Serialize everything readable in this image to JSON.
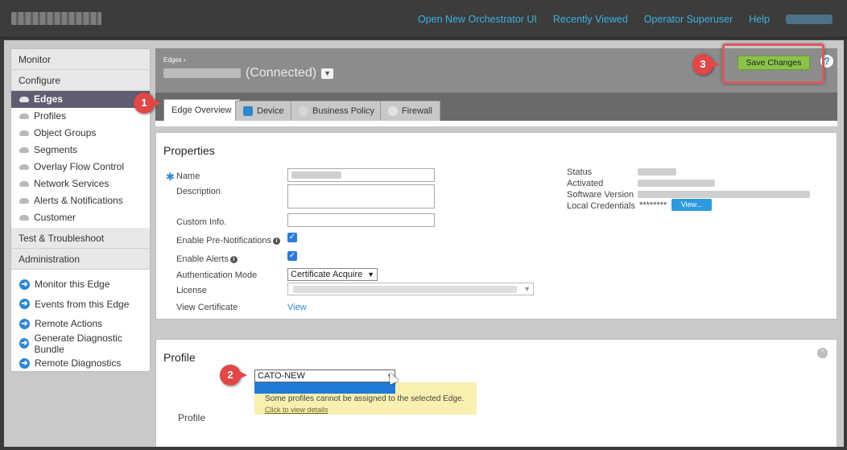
{
  "topnav": {
    "links": [
      "Open New Orchestrator UI",
      "Recently Viewed",
      "Operator Superuser",
      "Help"
    ]
  },
  "sidebar": {
    "monitor": "Monitor",
    "configure": "Configure",
    "items": [
      "Edges",
      "Profiles",
      "Object Groups",
      "Segments",
      "Overlay Flow Control",
      "Network Services",
      "Alerts & Notifications",
      "Customer"
    ],
    "test": "Test & Troubleshoot",
    "administration": "Administration",
    "actions": [
      "Monitor this Edge",
      "Events from this Edge",
      "Remote Actions",
      "Generate Diagnostic Bundle",
      "Remote Diagnostics"
    ]
  },
  "header": {
    "breadcrumb": "Edges ›",
    "status": "(Connected)",
    "save_label": "Save Changes",
    "help": "?"
  },
  "tabs": [
    "Edge Overview",
    "Device",
    "Business Policy",
    "Firewall"
  ],
  "properties": {
    "title": "Properties",
    "labels": {
      "name": "Name",
      "description": "Description",
      "custom_info": "Custom Info.",
      "pre_notifications": "Enable Pre-Notifications",
      "alerts": "Enable Alerts",
      "auth_mode": "Authentication Mode",
      "license": "License",
      "view_certificate": "View Certificate"
    },
    "auth_mode_value": "Certificate Acquire",
    "view_link": "View",
    "right": {
      "status": "Status",
      "activated": "Activated",
      "software_version": "Software Version",
      "local_credentials": "Local Credentials",
      "credentials_mask": "********",
      "view_button": "View..."
    }
  },
  "profile": {
    "title": "Profile",
    "label": "Profile",
    "selected": "CATO-NEW",
    "warning": "Some profiles cannot be assigned to the selected Edge.",
    "warning_link": "Click to view details"
  },
  "callouts": [
    "1",
    "2",
    "3"
  ],
  "colors": {
    "accent": "#2d86d0",
    "save": "#8bc34a",
    "callout": "#e04848"
  }
}
